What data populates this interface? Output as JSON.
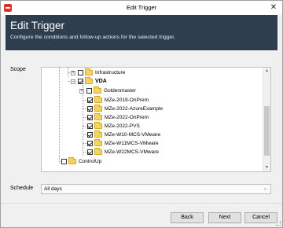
{
  "window": {
    "title": "Edit Trigger",
    "close_glyph": "✕",
    "app_icon": "app-logo-icon"
  },
  "header": {
    "title": "Edit Trigger",
    "subtitle": "Configure the conditions and follow-up actions for the selected trigger."
  },
  "scope": {
    "label": "Scope",
    "nodes": [
      {
        "id": "infrastructure",
        "label": "Infrastructure",
        "expander": "+",
        "checked": false,
        "bold": false
      },
      {
        "id": "vda",
        "label": "VDA",
        "expander": "−",
        "checked": true,
        "bold": true
      },
      {
        "id": "goldenmaster",
        "label": "Goldenmaster",
        "expander": "+",
        "checked": false,
        "bold": false
      },
      {
        "id": "mze-2019-onprem",
        "label": "MZe-2019-OnPrem",
        "checked": true,
        "bold": false
      },
      {
        "id": "mze-2022-azureexample",
        "label": "MZe-2022-AzureExample",
        "checked": true,
        "bold": false
      },
      {
        "id": "mze-2022-onprem",
        "label": "MZe-2022-OnPrem",
        "checked": true,
        "bold": false
      },
      {
        "id": "mze-2022-pvs",
        "label": "MZe-2022-PVS",
        "checked": true,
        "bold": false
      },
      {
        "id": "mze-w10-mcs-vmware",
        "label": "MZe-W10-MCS-VMware",
        "checked": true,
        "bold": false
      },
      {
        "id": "mze-w11mcs-vmware",
        "label": "MZe-W11MCS-VMware",
        "checked": true,
        "bold": false
      },
      {
        "id": "mze-w22mcs-vmware",
        "label": "MZe-W22MCS-VMware",
        "checked": true,
        "bold": false
      },
      {
        "id": "controlup",
        "label": "ControlUp",
        "checked": false,
        "bold": false
      }
    ]
  },
  "schedule": {
    "label": "Schedule",
    "value": "All days"
  },
  "footer": {
    "back_label": "Back",
    "next_label": "Next",
    "cancel_label": "Cancel"
  },
  "colors": {
    "header_bg": "#2e3e4e",
    "folder": "#f5d35c",
    "app_icon": "#e0302a"
  }
}
